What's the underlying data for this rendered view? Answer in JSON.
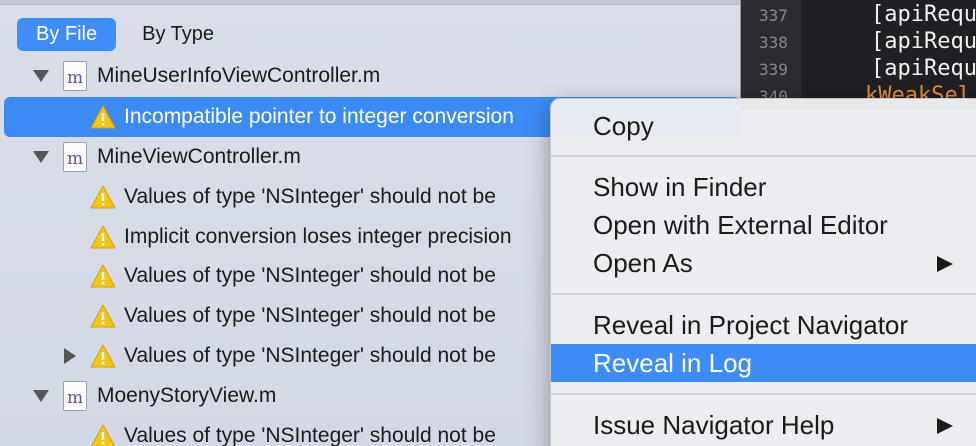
{
  "navigator": {
    "tabs": [
      {
        "label": "By File",
        "active": true
      },
      {
        "label": "By Type",
        "active": false
      }
    ],
    "rows": [
      {
        "kind": "file",
        "label": "MineUserInfoViewController.m",
        "expanded": true
      },
      {
        "kind": "issue",
        "label": "Incompatible pointer to integer conversion",
        "selected": true
      },
      {
        "kind": "file",
        "label": "MineViewController.m",
        "expanded": true
      },
      {
        "kind": "issue",
        "label": "Values of type 'NSInteger' should not be"
      },
      {
        "kind": "issue",
        "label": "Implicit conversion loses integer precision"
      },
      {
        "kind": "issue",
        "label": "Values of type 'NSInteger' should not be"
      },
      {
        "kind": "issue",
        "label": "Values of type 'NSInteger' should not be"
      },
      {
        "kind": "issue",
        "label": "Values of type 'NSInteger' should not be",
        "collapsed": true
      },
      {
        "kind": "file",
        "label": "MoenyStoryView.m",
        "expanded": true
      },
      {
        "kind": "issue",
        "label": "Values of type 'NSInteger' should not be"
      }
    ]
  },
  "editor": {
    "lines": [
      {
        "number": "337",
        "code": "[apiRequ"
      },
      {
        "number": "338",
        "code": "[apiRequ"
      },
      {
        "number": "339",
        "code": "[apiRequ"
      },
      {
        "number": "340",
        "code": "kWeakSel"
      }
    ]
  },
  "context_menu": {
    "items": [
      {
        "label": "Copy"
      },
      {
        "label": "Show in Finder"
      },
      {
        "label": "Open with External Editor"
      },
      {
        "label": "Open As",
        "submenu": true
      },
      {
        "label": "Reveal in Project Navigator"
      },
      {
        "label": "Reveal in Log",
        "highlighted": true
      },
      {
        "label": "Issue Navigator Help",
        "submenu": true
      }
    ]
  },
  "colors": {
    "selection_blue": "#3c8bf5",
    "warning_yellow": "#f5c518",
    "editor_background": "#1f1f24",
    "menu_highlight": "#3e8cf6"
  }
}
